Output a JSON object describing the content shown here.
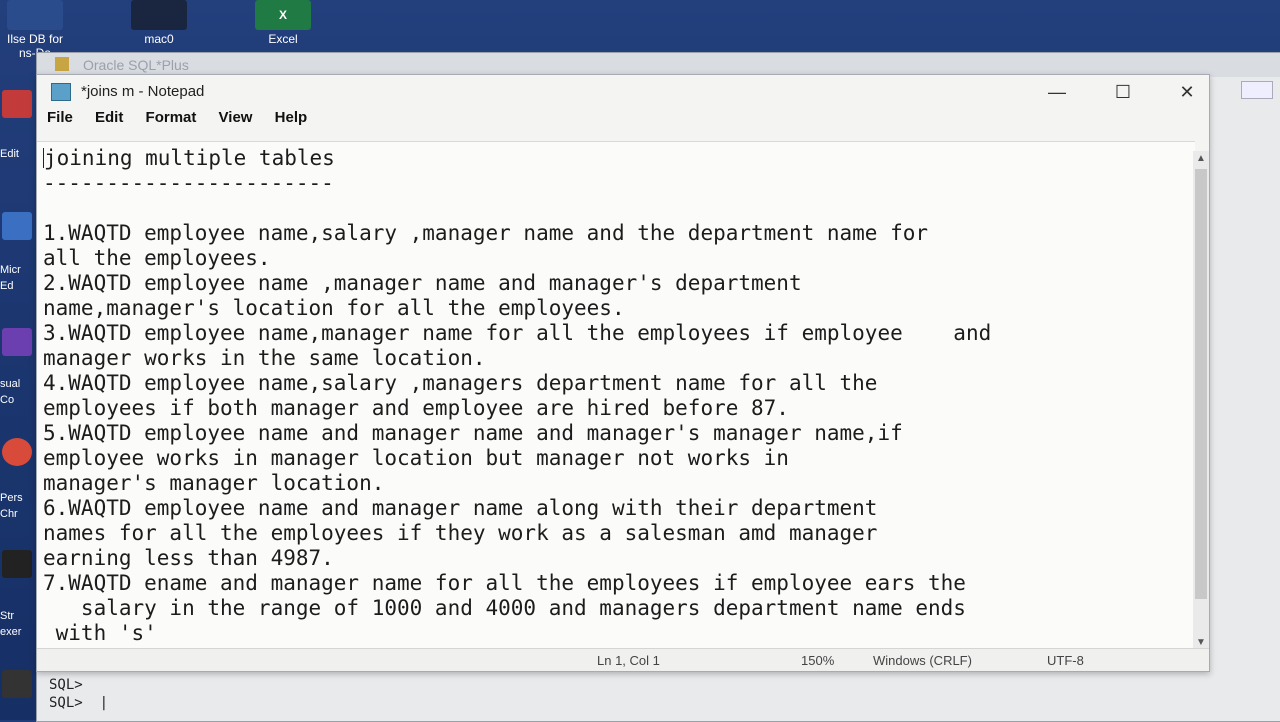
{
  "desktop": {
    "icons": [
      {
        "label": "Ilse DB for",
        "label2": "ns-Da"
      },
      {
        "label": "mac0"
      },
      {
        "label": "Excel"
      }
    ],
    "left_labels": [
      "Edit",
      "Micr",
      "Ed",
      "sual",
      "Co",
      "Pers",
      "Chr",
      "Str",
      "exer"
    ]
  },
  "sqlplus": {
    "title": "Oracle SQL*Plus",
    "prompts": [
      "SQL>",
      "SQL>"
    ]
  },
  "notepad": {
    "title": "*joins m - Notepad",
    "menu": [
      "File",
      "Edit",
      "Format",
      "View",
      "Help"
    ],
    "window_buttons": {
      "minimize": "—",
      "maximize": "☐",
      "close": "✕"
    },
    "lines": [
      "joining multiple tables",
      "-----------------------",
      "",
      "1.WAQTD employee name,salary ,manager name and the department name for",
      "all the employees.",
      "2.WAQTD employee name ,manager name and manager's department",
      "name,manager's location for all the employees.",
      "3.WAQTD employee name,manager name for all the employees if employee    and",
      "manager works in the same location.",
      "4.WAQTD employee name,salary ,managers department name for all the",
      "employees if both manager and employee are hired before 87.",
      "5.WAQTD employee name and manager name and manager's manager name,if",
      "employee works in manager location but manager not works in",
      "manager's manager location.",
      "6.WAQTD employee name and manager name along with their department",
      "names for all the employees if they work as a salesman amd manager",
      "earning less than 4987.",
      "7.WAQTD ename and manager name for all the employees if employee ears the",
      "   salary in the range of 1000 and 4000 and managers department name ends",
      " with 's'"
    ],
    "status": {
      "position": "Ln 1, Col 1",
      "zoom": "150%",
      "line_ending": "Windows (CRLF)",
      "encoding": "UTF-8"
    }
  }
}
